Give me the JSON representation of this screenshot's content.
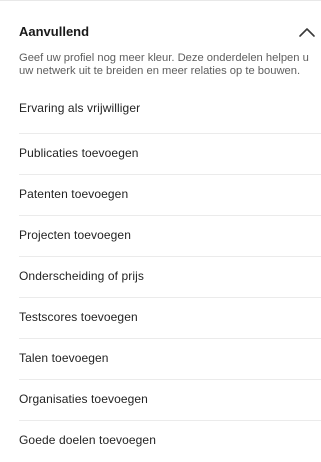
{
  "section": {
    "title": "Aanvullend",
    "description": "Geef uw profiel nog meer kleur. Deze onderdelen helpen u uw netwerk uit te breiden en meer relaties op te bouwen.",
    "collapse_icon": "chevron-up-icon"
  },
  "items": [
    {
      "label": "Ervaring als vrijwilliger"
    },
    {
      "label": "Publicaties toevoegen"
    },
    {
      "label": "Patenten toevoegen"
    },
    {
      "label": "Projecten toevoegen"
    },
    {
      "label": "Onderscheiding of prijs"
    },
    {
      "label": "Testscores toevoegen"
    },
    {
      "label": "Talen toevoegen"
    },
    {
      "label": "Organisaties toevoegen"
    },
    {
      "label": "Goede doelen toevoegen"
    }
  ],
  "colors": {
    "text_primary": "#191919",
    "text_secondary": "#5e5e5e",
    "divider": "#ebebeb",
    "background": "#ffffff"
  }
}
